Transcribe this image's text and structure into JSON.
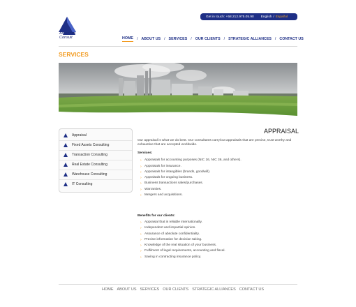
{
  "brand": {
    "name_line1": "American",
    "name_line2": "Consult",
    "color": "#1e2f86",
    "accent": "#f29a1e"
  },
  "topbar": {
    "contact": "Get in touch: +58.212.975.05.90",
    "lang_en": "English",
    "lang_sep": "/",
    "lang_es": "Español"
  },
  "nav": {
    "items": [
      "HOME",
      "ABOUT US",
      "SERVICES",
      "OUR CLIENTS",
      "STRATEGIC ALLIANCES",
      "CONTACT US"
    ],
    "separator": "/",
    "active": "HOME"
  },
  "page_title": "SERVICES",
  "sidebar": {
    "items": [
      {
        "label": "Appraisal",
        "icon": "triangle-bullet-icon"
      },
      {
        "label": "Fixed Assets Consulting",
        "icon": "triangle-bullet-icon"
      },
      {
        "label": "Transaction Consulting",
        "icon": "triangle-bullet-icon"
      },
      {
        "label": "Real Estate Consulting",
        "icon": "triangle-bullet-icon"
      },
      {
        "label": "Warehouse Consulting",
        "icon": "triangle-bullet-icon"
      },
      {
        "label": "IT Consulting",
        "icon": "triangle-bullet-icon"
      }
    ]
  },
  "content": {
    "title": "APPRAISAL",
    "intro": "Our appraisal is what we do best. Our consultants carry/out appraisals that are precise, trust worthy and exhaustive that are accepted worldwide.",
    "services_heading": "Services:",
    "services": [
      "Appraisals for accounting purposes (NIC 16, NIC 36, and others).",
      "Appraisals for insurance.",
      "Appraisals for intangibles (brands, goodwill).",
      "Appraisals for ongoing business.",
      "Business transactions sales/purchases.",
      "Warranties.",
      "Mergers and acquisitions."
    ],
    "benefits_heading": "Benefits for our clients:",
    "benefits": [
      "Appraisal that is reliable internationally.",
      "Independent and impartial opinion.",
      "Assurance of absolute confidentiality.",
      "Precise information for decision taking.",
      "Knowledge of the real situation of your business.",
      "Fulfilment of legal requirements, accounting and fiscal.",
      "Saving in contracting insurance policy."
    ],
    "bullet_glyph": "›"
  },
  "footer": {
    "items": [
      "HOME",
      "ABOUT US",
      "SERVICES",
      "OUR CLIENTS",
      "STRATEGIC ALLIANCES",
      "CONTACT US"
    ]
  }
}
